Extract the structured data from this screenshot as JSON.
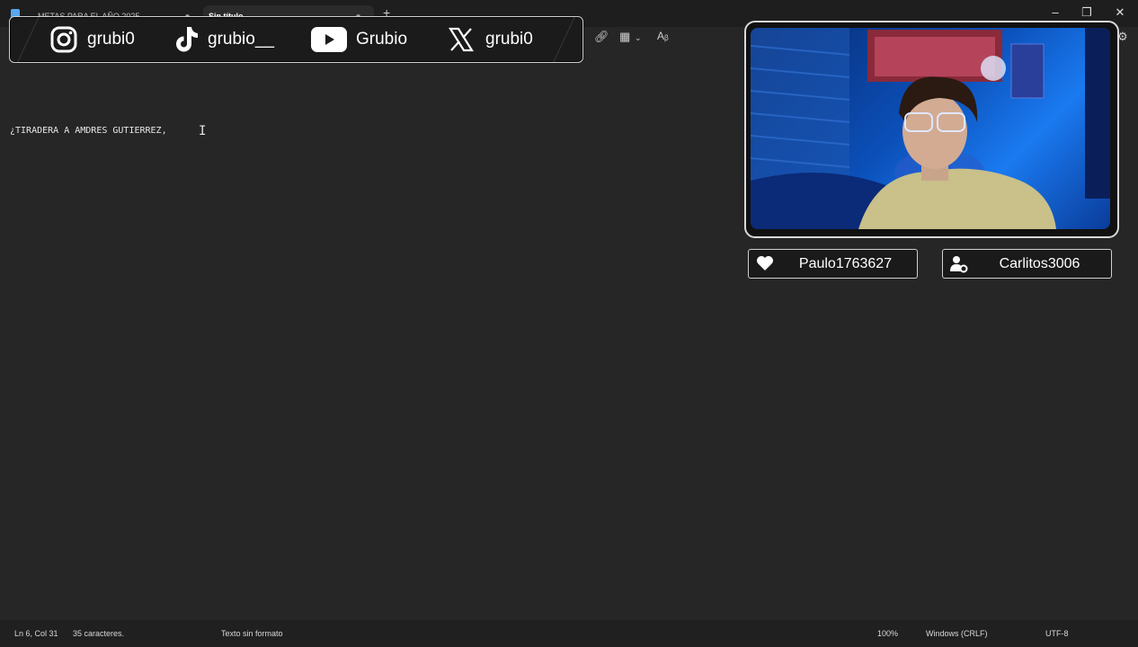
{
  "tabs": [
    {
      "label": "METAS PARA EL AÑO 2025"
    },
    {
      "label": "Sin título"
    }
  ],
  "new_tab_label": "+",
  "editor": {
    "line_text": "¿TIRADERA A AMDRES GUTIERREZ,"
  },
  "status": {
    "position": "Ln 6, Col 31",
    "chars": "35 caracteres.",
    "format": "Texto sin formato",
    "zoom": "100%",
    "line_ending": "Windows (CRLF)",
    "encoding": "UTF-8"
  },
  "social": {
    "instagram": "grubi0",
    "tiktok": "grubio__",
    "youtube": "Grubio",
    "x": "grubi0"
  },
  "badges": {
    "follower": "Paulo1763627",
    "subscriber": "Carlitos3006"
  }
}
